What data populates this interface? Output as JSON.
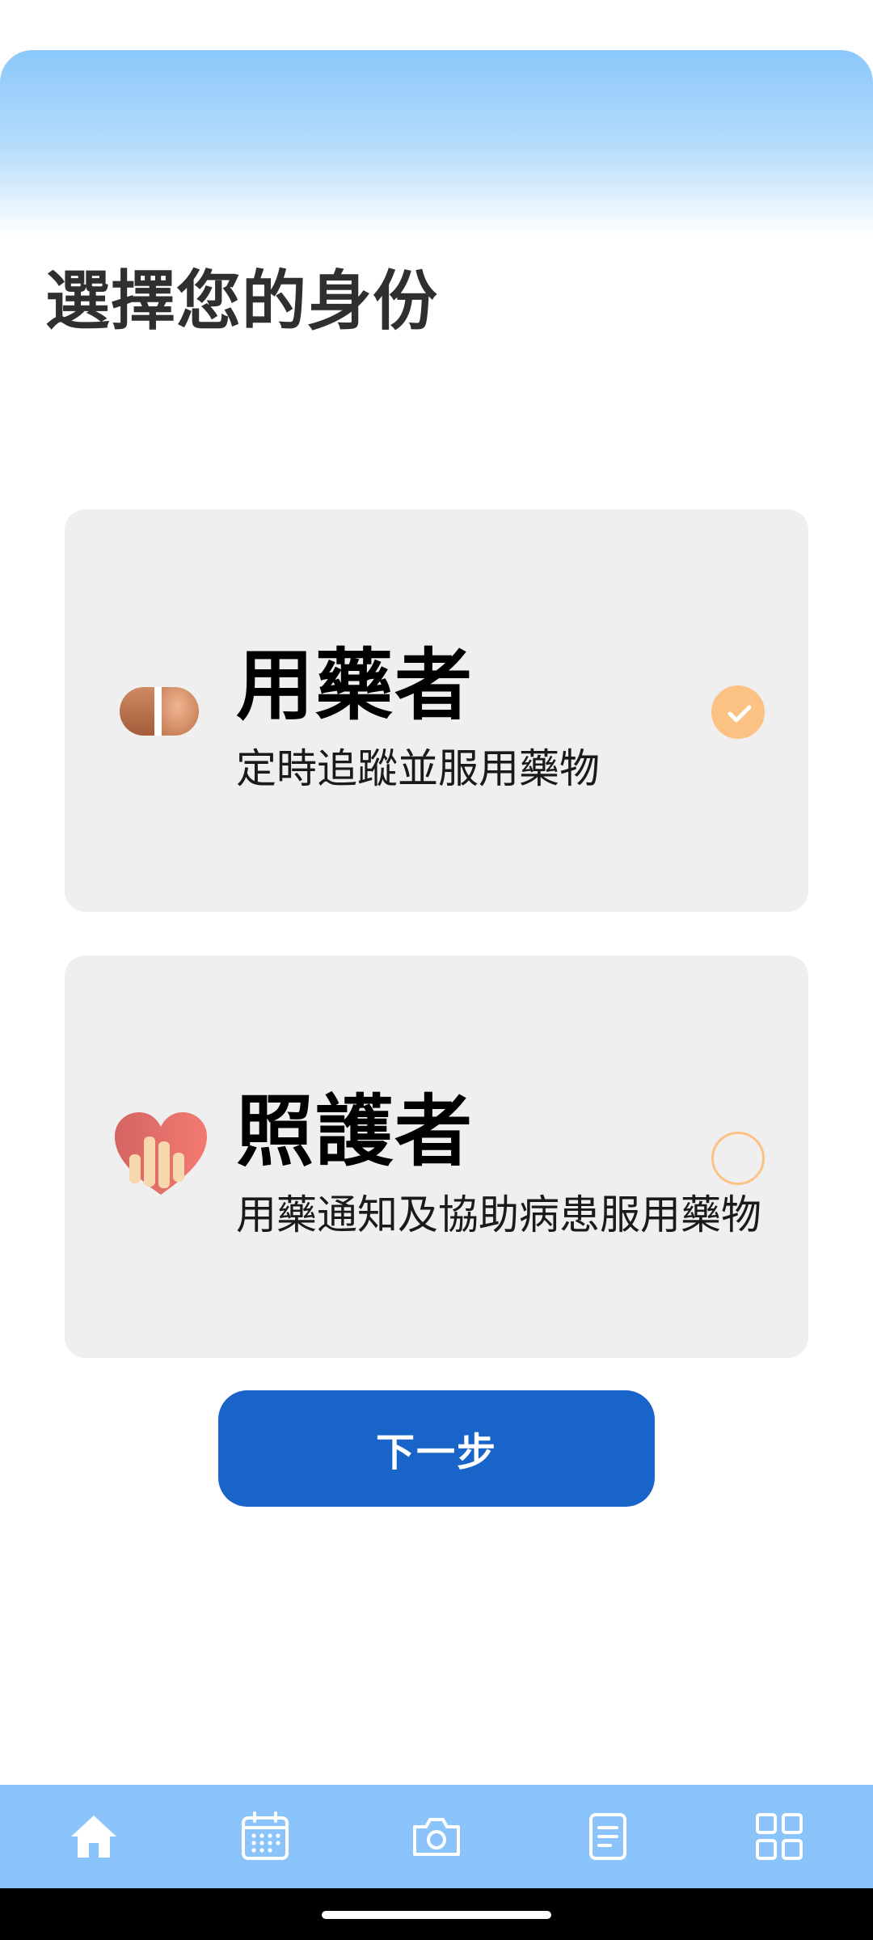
{
  "page": {
    "title": "選擇您的身份"
  },
  "roles": [
    {
      "name": "用藥者",
      "description": "定時追蹤並服用藥物",
      "icon": "pill-icon",
      "selected": true
    },
    {
      "name": "照護者",
      "description": "用藥通知及協助病患服用藥物",
      "icon": "heart-hands-icon",
      "selected": false
    }
  ],
  "actions": {
    "next_label": "下一步"
  },
  "bottom_nav": [
    {
      "icon": "home-icon"
    },
    {
      "icon": "calendar-icon"
    },
    {
      "icon": "camera-icon"
    },
    {
      "icon": "document-icon"
    },
    {
      "icon": "grid-icon"
    }
  ],
  "colors": {
    "accent": "#fbc283",
    "primary_button": "#1864c9",
    "nav_background": "#8ac4fb",
    "card_background": "#efeff0"
  }
}
